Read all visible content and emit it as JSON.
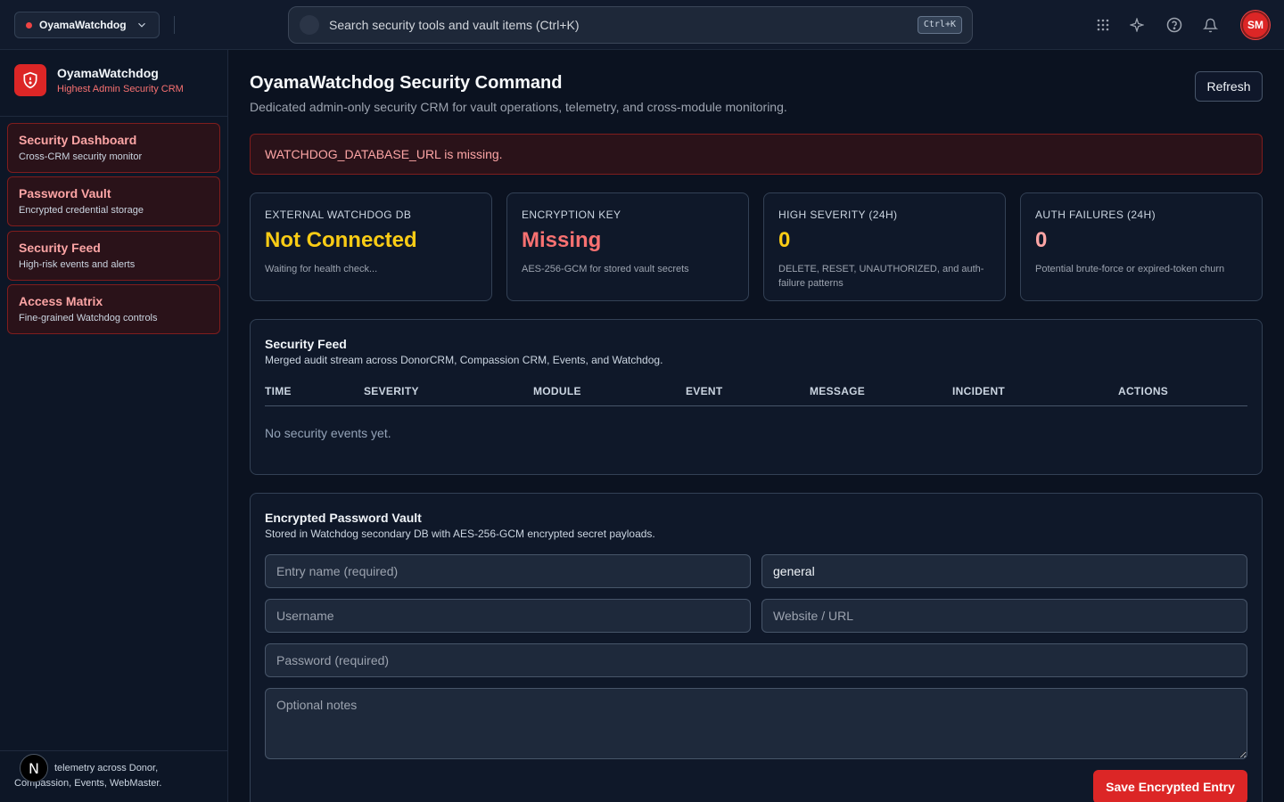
{
  "topbar": {
    "app_name": "OyamaWatchdog",
    "search_placeholder": "Search security tools and vault items (Ctrl+K)",
    "search_shortcut": "Ctrl+K",
    "avatar_initials": "SM"
  },
  "sidebar": {
    "brand_name": "OyamaWatchdog",
    "brand_subtitle": "Highest Admin Security CRM",
    "items": [
      {
        "label": "Security Dashboard",
        "sub": "Cross-CRM security monitor"
      },
      {
        "label": "Password Vault",
        "sub": "Encrypted credential storage"
      },
      {
        "label": "Security Feed",
        "sub": "High-risk events and alerts"
      },
      {
        "label": "Access Matrix",
        "sub": "Fine-grained Watchdog controls"
      }
    ],
    "footer_visible_text": "telemetry across Donor,",
    "footer_line_2": "Compassion, Events, WebMaster.",
    "footer_badge": "N"
  },
  "main": {
    "title": "OyamaWatchdog Security Command",
    "subtitle": "Dedicated admin-only security CRM for vault operations, telemetry, and cross-module monitoring.",
    "refresh_label": "Refresh",
    "alert_text": "WATCHDOG_DATABASE_URL is missing."
  },
  "stats": [
    {
      "label": "EXTERNAL WATCHDOG DB",
      "value": "Not Connected",
      "desc": "Waiting for health check...",
      "color": "#facc15"
    },
    {
      "label": "ENCRYPTION KEY",
      "value": "Missing",
      "desc": "AES-256-GCM for stored vault secrets",
      "color": "#f87171"
    },
    {
      "label": "HIGH SEVERITY (24H)",
      "value": "0",
      "desc": "DELETE, RESET, UNAUTHORIZED, and auth-failure patterns",
      "color": "#facc15"
    },
    {
      "label": "AUTH FAILURES (24H)",
      "value": "0",
      "desc": "Potential brute-force or expired-token churn",
      "color": "#fca5a5"
    }
  ],
  "feed": {
    "title": "Security Feed",
    "subtitle": "Merged audit stream across DonorCRM, Compassion CRM, Events, and Watchdog.",
    "columns": [
      "TIME",
      "SEVERITY",
      "MODULE",
      "EVENT",
      "MESSAGE",
      "INCIDENT",
      "ACTIONS"
    ],
    "empty_text": "No security events yet."
  },
  "vault": {
    "title": "Encrypted Password Vault",
    "subtitle": "Stored in Watchdog secondary DB with AES-256-GCM encrypted secret payloads.",
    "entry_name_placeholder": "Entry name (required)",
    "category_value": "general",
    "username_placeholder": "Username",
    "website_placeholder": "Website / URL",
    "password_placeholder": "Password (required)",
    "notes_placeholder": "Optional notes",
    "save_label": "Save Encrypted Entry"
  }
}
